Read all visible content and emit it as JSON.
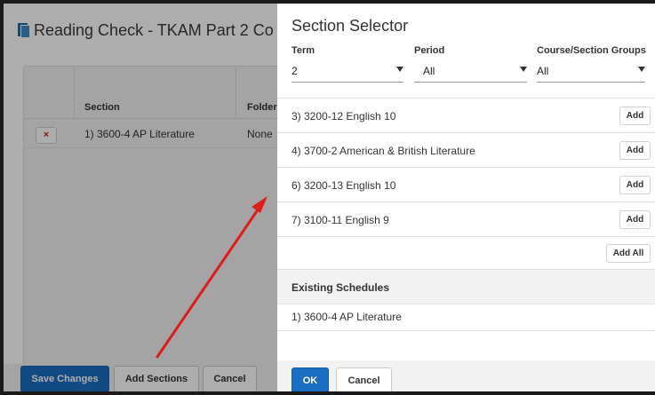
{
  "background_page": {
    "title": "Reading Check - TKAM Part 2 Co",
    "table": {
      "headers": [
        "Section",
        "Folder"
      ],
      "rows": [
        {
          "delete_icon": "×",
          "section": "1) 3600-4 AP Literature",
          "folder": "None"
        }
      ]
    },
    "footer": {
      "save_label": "Save Changes",
      "add_sections_label": "Add Sections",
      "cancel_label": "Cancel"
    }
  },
  "section_selector": {
    "title": "Section Selector",
    "filters": {
      "term": {
        "label": "Term",
        "value": "2"
      },
      "period": {
        "label": "Period",
        "value": "All"
      },
      "groups": {
        "label": "Course/Section Groups",
        "value": "All"
      }
    },
    "available_sections": [
      {
        "name": "3) 3200-12 English 10",
        "action": "Add"
      },
      {
        "name": "4) 3700-2 American & British Literature",
        "action": "Add"
      },
      {
        "name": "6) 3200-13 English 10",
        "action": "Add"
      },
      {
        "name": "7) 3100-11 English 9",
        "action": "Add"
      }
    ],
    "add_all_label": "Add All",
    "existing_header": "Existing Schedules",
    "existing": [
      "1) 3600-4 AP Literature"
    ],
    "ok_label": "OK",
    "cancel_label": "Cancel"
  },
  "colors": {
    "primary": "#1b6ec2",
    "annotation_arrow": "#e01b1b",
    "delete": "#c62828"
  },
  "icons": {
    "document": "document-icon",
    "dropdown": "chevron-down-icon",
    "delete": "close-icon"
  }
}
